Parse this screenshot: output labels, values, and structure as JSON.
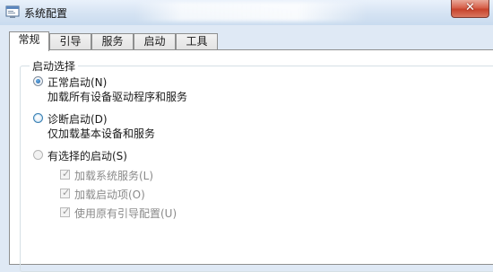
{
  "window": {
    "title": "系统配置",
    "close_glyph": "✕"
  },
  "tabs": [
    {
      "label": "常规",
      "active": true
    },
    {
      "label": "引导",
      "active": false
    },
    {
      "label": "服务",
      "active": false
    },
    {
      "label": "启动",
      "active": false
    },
    {
      "label": "工具",
      "active": false
    }
  ],
  "startup_group": {
    "legend": "启动选择",
    "options": [
      {
        "label": "正常启动(N)",
        "description": "加载所有设备驱动程序和服务",
        "selected": true
      },
      {
        "label": "诊断启动(D)",
        "description": "仅加载基本设备和服务",
        "selected": false
      },
      {
        "label": "有选择的启动(S)",
        "selected": false
      }
    ],
    "selective_items": [
      {
        "label": "加载系统服务(L)",
        "checked": true,
        "enabled": false
      },
      {
        "label": "加载启动项(O)",
        "checked": true,
        "enabled": false
      },
      {
        "label": "使用原有引导配置(U)",
        "checked": true,
        "enabled": false
      }
    ]
  },
  "icons": {
    "app": "msconfig-window-icon",
    "close": "close-icon",
    "check": "checkmark-icon"
  },
  "colors": {
    "titlebar": "#d5e3f3",
    "close_button": "#c7432c",
    "radio_selected": "#1f5f9e"
  }
}
